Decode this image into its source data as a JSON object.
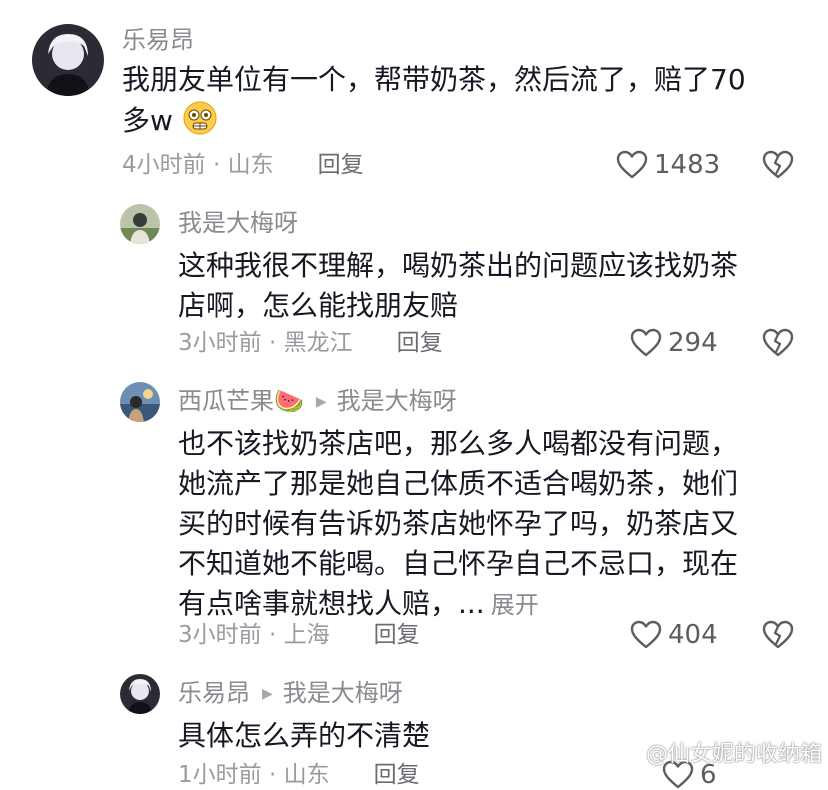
{
  "comments": [
    {
      "author": "乐易昂",
      "lines": [
        "我朋友单位有一个，帮带奶茶，然后流了，赔了70",
        "多w"
      ],
      "emoji": "flushed-emoji",
      "time_location": "4小时前 · 山东",
      "reply_label": "回复",
      "likes": "1483"
    },
    {
      "author": "我是大梅呀",
      "lines": [
        "这种我很不理解，喝奶茶出的问题应该找奶茶",
        "店啊，怎么能找朋友赔"
      ],
      "time_location": "3小时前 · 黑龙江",
      "reply_label": "回复",
      "likes": "294"
    },
    {
      "author": "西瓜芒果🍉",
      "reply_to": "我是大梅呀",
      "lines": [
        "也不该找奶茶店吧，那么多人喝都没有问题，",
        "她流产了那是她自己体质不适合喝奶茶，她们",
        "买的时候有告诉奶茶店她怀孕了吗，奶茶店又",
        "不知道她不能喝。自己怀孕自己不忌口，现在",
        "有点啥事就想找人赔，..."
      ],
      "expand_label": "展开",
      "time_location": "3小时前 · 上海",
      "reply_label": "回复",
      "likes": "404"
    },
    {
      "author": "乐易昂",
      "reply_to": "我是大梅呀",
      "lines": [
        "具体怎么弄的不清楚"
      ],
      "time_location": "1小时前 · 山东",
      "reply_label": "回复",
      "likes": "6"
    }
  ],
  "watermark": "@仙女妮的收纳箱",
  "icons": {
    "like": "heart-outline-icon",
    "dislike": "broken-heart-icon",
    "reply_arrow": "triangle-right-icon"
  },
  "colors": {
    "name": "#8a8b91",
    "body": "#161823",
    "meta": "#9a9ba0",
    "icon": "#5c5d63"
  }
}
